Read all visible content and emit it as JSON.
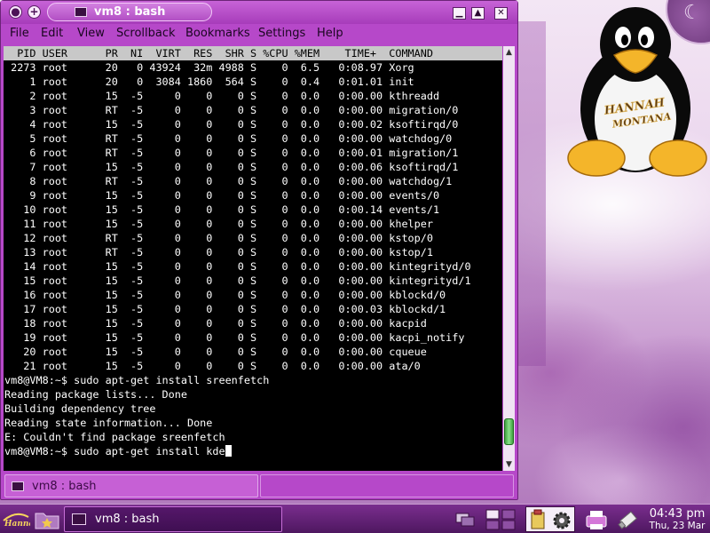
{
  "window": {
    "title": "vm8 : bash",
    "menu": [
      "File",
      "Edit",
      "View",
      "Scrollback",
      "Bookmarks",
      "Settings",
      "Help"
    ],
    "session_tab": "vm8 : bash"
  },
  "terminal": {
    "top_header": "  PID USER      PR  NI  VIRT  RES  SHR S %CPU %MEM    TIME+  COMMAND",
    "processes": [
      " 2273 root      20   0 43924  32m 4988 S    0  6.5   0:08.97 Xorg",
      "    1 root      20   0  3084 1860  564 S    0  0.4   0:01.01 init",
      "    2 root      15  -5     0    0    0 S    0  0.0   0:00.00 kthreadd",
      "    3 root      RT  -5     0    0    0 S    0  0.0   0:00.00 migration/0",
      "    4 root      15  -5     0    0    0 S    0  0.0   0:00.02 ksoftirqd/0",
      "    5 root      RT  -5     0    0    0 S    0  0.0   0:00.00 watchdog/0",
      "    6 root      RT  -5     0    0    0 S    0  0.0   0:00.01 migration/1",
      "    7 root      15  -5     0    0    0 S    0  0.0   0:00.06 ksoftirqd/1",
      "    8 root      RT  -5     0    0    0 S    0  0.0   0:00.00 watchdog/1",
      "    9 root      15  -5     0    0    0 S    0  0.0   0:00.00 events/0",
      "   10 root      15  -5     0    0    0 S    0  0.0   0:00.14 events/1",
      "   11 root      15  -5     0    0    0 S    0  0.0   0:00.00 khelper",
      "   12 root      RT  -5     0    0    0 S    0  0.0   0:00.00 kstop/0",
      "   13 root      RT  -5     0    0    0 S    0  0.0   0:00.00 kstop/1",
      "   14 root      15  -5     0    0    0 S    0  0.0   0:00.00 kintegrityd/0",
      "   15 root      15  -5     0    0    0 S    0  0.0   0:00.00 kintegrityd/1",
      "   16 root      15  -5     0    0    0 S    0  0.0   0:00.00 kblockd/0",
      "   17 root      15  -5     0    0    0 S    0  0.0   0:00.03 kblockd/1",
      "   18 root      15  -5     0    0    0 S    0  0.0   0:00.00 kacpid",
      "   19 root      15  -5     0    0    0 S    0  0.0   0:00.00 kacpi_notify",
      "   20 root      15  -5     0    0    0 S    0  0.0   0:00.00 cqueue",
      "   21 root      15  -5     0    0    0 S    0  0.0   0:00.00 ata/0"
    ],
    "output": [
      "vm8@VM8:~$ sudo apt-get install sreenfetch",
      "Reading package lists... Done",
      "Building dependency tree",
      "Reading state information... Done",
      "E: Couldn't find package sreenfetch"
    ],
    "current_command": "vm8@VM8:~$ sudo apt-get install kde"
  },
  "wallpaper": {
    "badge_line1": "HANNAH",
    "badge_line2": "MONTANA"
  },
  "taskbar": {
    "launcher_text": "Hannah",
    "task_button": "vm8 : bash",
    "clock_time": "04:43 pm",
    "clock_date": "Thu, 23 Mar"
  },
  "colors": {
    "window_frame": "#b648c9",
    "terminal_bg": "#000000",
    "terminal_fg": "#ffffff",
    "top_header_bg": "#c8c8c8",
    "taskbar": "#5e1c73",
    "scroll_thumb": "#3ea23e"
  },
  "icons": [
    "tux-penguin",
    "terminal-icon",
    "folder-icon",
    "monitor-icon",
    "printer-icon",
    "clipboard-icon",
    "gear-icon",
    "usb-drive-icon"
  ]
}
